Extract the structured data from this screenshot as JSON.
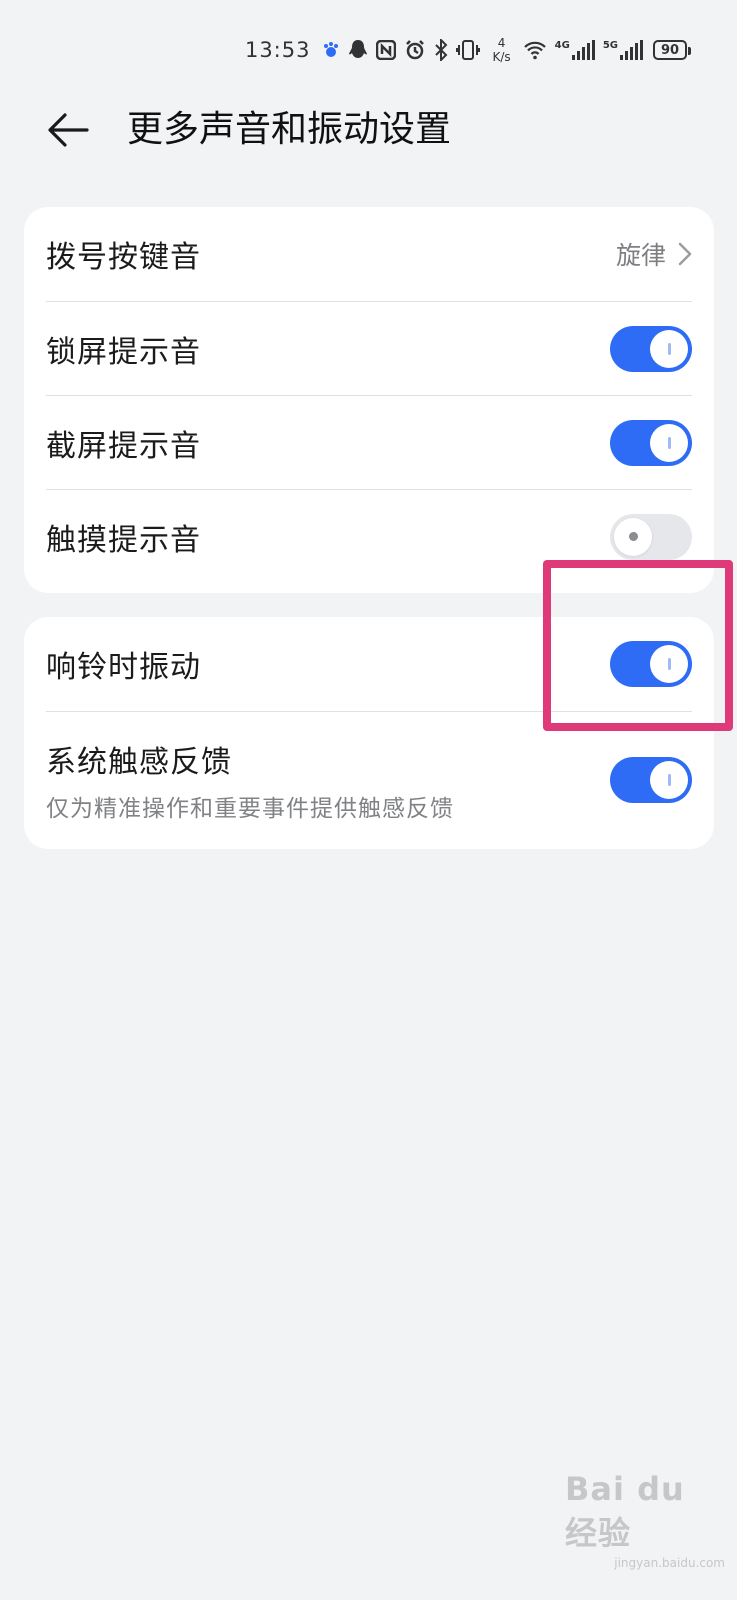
{
  "status_bar": {
    "time": "13:53",
    "speed_value": "4",
    "speed_unit": "K/s",
    "net1": "4G",
    "net2": "5G",
    "battery": "90",
    "icons": [
      "baidu-paw-icon",
      "qq-icon",
      "nfc-icon",
      "alarm-icon",
      "bluetooth-icon",
      "vibrate-icon",
      "wifi-icon",
      "signal-icon",
      "signal-icon",
      "battery-icon"
    ]
  },
  "header": {
    "title": "更多声音和振动设置",
    "back_icon": "arrow-left-icon"
  },
  "card1": {
    "rows": [
      {
        "label": "拨号按键音",
        "value": "旋律",
        "type": "link"
      },
      {
        "label": "锁屏提示音",
        "type": "toggle",
        "on": true
      },
      {
        "label": "截屏提示音",
        "type": "toggle",
        "on": true
      },
      {
        "label": "触摸提示音",
        "type": "toggle",
        "on": false
      }
    ]
  },
  "card2": {
    "rows": [
      {
        "label": "响铃时振动",
        "type": "toggle",
        "on": true
      },
      {
        "label": "系统触感反馈",
        "sub": "仅为精准操作和重要事件提供触感反馈",
        "type": "toggle",
        "on": true
      }
    ]
  },
  "colors": {
    "accent": "#2e6cf6",
    "background": "#f1f3f5",
    "highlight": "#de3a79"
  },
  "watermark": {
    "main": "Bai du 经验",
    "sub": "jingyan.baidu.com"
  }
}
